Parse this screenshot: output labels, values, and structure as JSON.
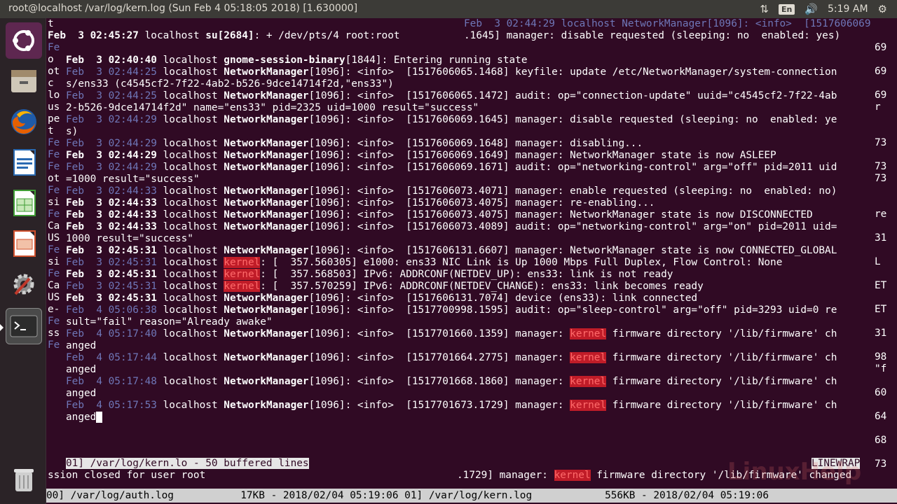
{
  "window": {
    "title": "root@localhost /var/log/kern.log (Sun Feb  4 05:18:05 2018) [1.630000]"
  },
  "tray": {
    "network_icon": "network-updown-icon",
    "lang": "En",
    "volume_icon": "volume-icon",
    "clock": "5:19 AM",
    "gear_icon": "gear-icon"
  },
  "launcher": [
    {
      "name": "ubuntu-dash-icon"
    },
    {
      "name": "files-icon"
    },
    {
      "name": "firefox-icon"
    },
    {
      "name": "writer-icon"
    },
    {
      "name": "calc-icon"
    },
    {
      "name": "impress-icon"
    },
    {
      "name": "settings-icon"
    },
    {
      "name": "terminal-icon"
    },
    {
      "name": "trash-icon"
    }
  ],
  "terminal": {
    "top_left": [
      "t",
      "Feb  3 02:45:27 localhost su[2684]: + /dev/pts/4 root:root"
    ],
    "top_right": [
      "Feb  3 02:44:29 localhost NetworkManager[1096]: <info>  [1517606069",
      ".1645] manager: disable requested (sleeping: no  enabled: yes)"
    ],
    "left_gutter": [
      "Fe",
      "o",
      "ot",
      "c",
      "lo",
      "us",
      "pe",
      "t",
      "Fe",
      "Fe",
      "Fe",
      "ot",
      "Fe",
      "si",
      "Fe",
      "Ca",
      "US",
      "Fe",
      "si",
      "Fe",
      "Ca",
      "US",
      "e-",
      "Fe",
      "ss",
      "Fe"
    ],
    "right_gutter": [
      "69",
      "69",
      "69",
      "r",
      "73",
      "73",
      "73",
      "re",
      "31",
      "L",
      "ET",
      "ET",
      "31",
      "98",
      "\"f",
      "60",
      "64",
      "68",
      "73"
    ],
    "log_lines": [
      {
        "ts": "Feb  3 02:40:40",
        "host": "localhost",
        "proc": "gnome-session-binary[1844]",
        "msg": ": Entering running state"
      },
      {
        "ts": "Feb  3 02:44:25",
        "host": "localhost",
        "proc": "NetworkManager[1096]",
        "msg": ": <info>  [1517606065.1468] keyfile: update /etc/NetworkManager/system-connection"
      },
      {
        "cont": "s/ens33 (c4545cf2-7f22-4ab2-b526-9dce14714f2d,\"ens33\")"
      },
      {
        "ts": "Feb  3 02:44:25",
        "host": "localhost",
        "proc": "NetworkManager[1096]",
        "msg": ": <info>  [1517606065.1472] audit: op=\"connection-update\" uuid=\"c4545cf2-7f22-4ab"
      },
      {
        "cont": "2-b526-9dce14714f2d\" name=\"ens33\" pid=2325 uid=1000 result=\"success\""
      },
      {
        "ts": "Feb  3 02:44:29",
        "host": "localhost",
        "proc": "NetworkManager[1096]",
        "msg": ": <info>  [1517606069.1645] manager: disable requested (sleeping: no  enabled: ye"
      },
      {
        "cont": "s)"
      },
      {
        "ts": "Feb  3 02:44:29",
        "host": "localhost",
        "proc": "NetworkManager[1096]",
        "msg": ": <info>  [1517606069.1648] manager: disabling..."
      },
      {
        "ts": "Feb  3 02:44:29",
        "host": "localhost",
        "proc": "NetworkManager[1096]",
        "msg": ": <info>  [1517606069.1649] manager: NetworkManager state is now ASLEEP",
        "bold_ts": true
      },
      {
        "ts": "Feb  3 02:44:29",
        "host": "localhost",
        "proc": "NetworkManager[1096]",
        "msg": ": <info>  [1517606069.1671] audit: op=\"networking-control\" arg=\"off\" pid=2011 uid"
      },
      {
        "cont": "=1000 result=\"success\""
      },
      {
        "ts": "Feb  3 02:44:33",
        "host": "localhost",
        "proc": "NetworkManager[1096]",
        "msg": ": <info>  [1517606073.4071] manager: enable requested (sleeping: no  enabled: no)"
      },
      {
        "ts": "Feb  3 02:44:33",
        "host": "localhost",
        "proc": "NetworkManager[1096]",
        "msg": ": <info>  [1517606073.4075] manager: re-enabling...",
        "bold_ts": true
      },
      {
        "ts": "Feb  3 02:44:33",
        "host": "localhost",
        "proc": "NetworkManager[1096]",
        "msg": ": <info>  [1517606073.4075] manager: NetworkManager state is now DISCONNECTED",
        "bold_ts": true
      },
      {
        "ts": "Feb  3 02:44:33",
        "host": "localhost",
        "proc": "NetworkManager[1096]",
        "msg": ": <info>  [1517606073.4089] audit: op=\"networking-control\" arg=\"on\" pid=2011 uid=",
        "bold_ts": true
      },
      {
        "cont": "1000 result=\"success\""
      },
      {
        "ts": "Feb  3 02:45:31",
        "host": "localhost",
        "proc": "NetworkManager[1096]",
        "msg": ": <info>  [1517606131.6607] manager: NetworkManager state is now CONNECTED_GLOBAL",
        "bold_ts": true
      },
      {
        "ts": "Feb  3 02:45:31",
        "host": "localhost",
        "kernel": "kernel",
        "msg": ": [  357.560305] e1000: ens33 NIC Link is Up 1000 Mbps Full Duplex, Flow Control: None"
      },
      {
        "ts": "Feb  3 02:45:31",
        "host": "localhost",
        "kernel": "kernel",
        "msg": ": [  357.568503] IPv6: ADDRCONF(NETDEV_UP): ens33: link is not ready",
        "bold_ts": true
      },
      {
        "ts": "Feb  3 02:45:31",
        "host": "localhost",
        "kernel": "kernel",
        "msg": ": [  357.570259] IPv6: ADDRCONF(NETDEV_CHANGE): ens33: link becomes ready"
      },
      {
        "ts": "Feb  3 02:45:31",
        "host": "localhost",
        "proc": "NetworkManager[1096]",
        "msg": ": <info>  [1517606131.7074] device (ens33): link connected",
        "bold_ts": true
      },
      {
        "ts": "Feb  4 05:06:38",
        "host": "localhost",
        "proc": "NetworkManager[1096]",
        "msg": ": <info>  [1517700998.1595] audit: op=\"sleep-control\" arg=\"off\" pid=3293 uid=0 re"
      },
      {
        "cont": "sult=\"fail\" reason=\"Already awake\""
      },
      {
        "ts": "Feb  4 05:17:40",
        "host": "localhost",
        "proc": "NetworkManager[1096]",
        "msg": ": <info>  [1517701660.1359] manager: ",
        "kernel_mid": "kernel",
        "tail": " firmware directory '/lib/firmware' ch"
      },
      {
        "cont": "anged"
      },
      {
        "ts": "Feb  4 05:17:44",
        "host": "localhost",
        "proc": "NetworkManager[1096]",
        "msg": ": <info>  [1517701664.2775] manager: ",
        "kernel_mid": "kernel",
        "tail": " firmware directory '/lib/firmware' ch"
      },
      {
        "cont": "anged"
      },
      {
        "ts": "Feb  4 05:17:48",
        "host": "localhost",
        "proc": "NetworkManager[1096]",
        "msg": ": <info>  [1517701668.1860] manager: ",
        "kernel_mid": "kernel",
        "tail": " firmware directory '/lib/firmware' ch"
      },
      {
        "cont": "anged"
      },
      {
        "ts": "Feb  4 05:17:53",
        "host": "localhost",
        "proc": "NetworkManager[1096]",
        "msg": ": <info>  [1517701673.1729] manager: ",
        "kernel_mid": "kernel",
        "tail": " firmware directory '/lib/firmware' ch"
      },
      {
        "cont": "anged",
        "cursor": true
      }
    ],
    "inner_status": "01] /var/log/kern.lo - 50 buffered lines",
    "linewrap_label": "LINEWRAP",
    "session_line_left": "ssion closed for user root",
    "session_line_right_pre": ".1729] manager: ",
    "session_line_right_kernel": "kernel",
    "session_line_right_post": " firmware directory '/lib/firmware' changed",
    "bottom_bar": "00] /var/log/auth.log           17KB - 2018/02/04 05:19:06 01] /var/log/kern.log            556KB - 2018/02/04 05:19:06",
    "watermark": "LinuxHelp"
  }
}
